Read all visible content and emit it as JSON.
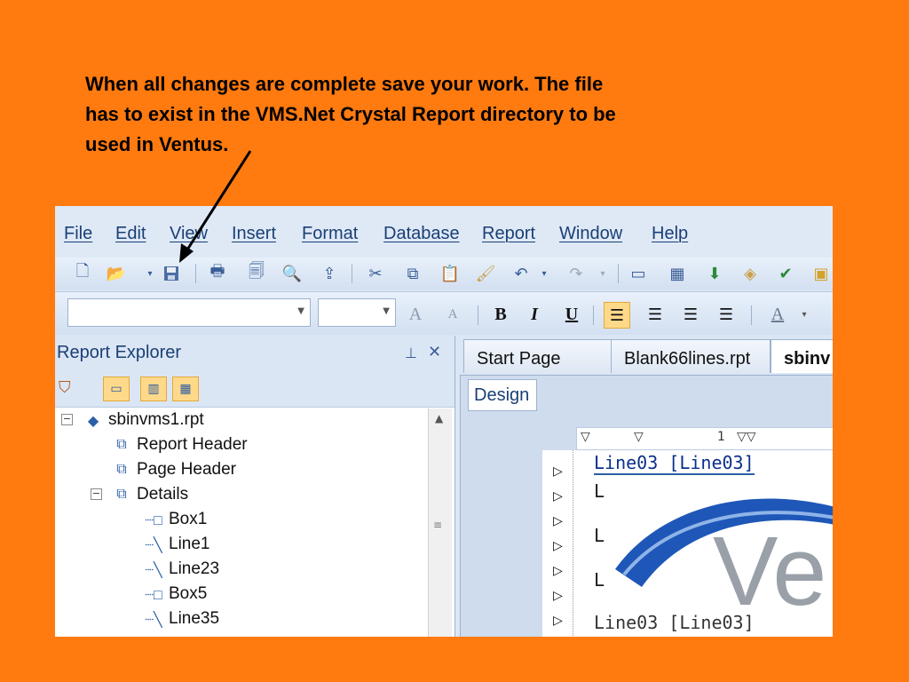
{
  "caption": {
    "line1": "When all changes are complete save your work.  The file",
    "line2": "has to exist in the VMS.Net Crystal Report directory to be",
    "line3": "used in Ventus."
  },
  "menu": [
    "File",
    "Edit",
    "View",
    "Insert",
    "Format",
    "Database",
    "Report",
    "Window",
    "Help"
  ],
  "toolbar_icons": [
    "new-icon",
    "open-icon",
    "save-icon",
    "print-icon",
    "print-preview-icon",
    "preview-icon",
    "export-icon",
    "cut-icon",
    "copy-icon",
    "paste-icon",
    "format-painter-icon",
    "undo-icon",
    "redo-icon",
    "field-explorer-icon",
    "toolbox-icon",
    "insert-icon",
    "expert-icon",
    "check-icon"
  ],
  "format": {
    "bold": "B",
    "italic": "I",
    "underline": "U",
    "font_grow": "A",
    "font_shrink": "A",
    "font_color": "A"
  },
  "explorer": {
    "title": "Report Explorer",
    "pin": "ф",
    "close": "✕",
    "items": [
      {
        "label": "sbinvms1.rpt",
        "type": "report"
      },
      {
        "label": "Report Header",
        "type": "section"
      },
      {
        "label": "Page Header",
        "type": "section"
      },
      {
        "label": "Details",
        "type": "section"
      },
      {
        "label": "Box1",
        "type": "box"
      },
      {
        "label": "Line1",
        "type": "line"
      },
      {
        "label": "Line23",
        "type": "line"
      },
      {
        "label": "Box5",
        "type": "box"
      },
      {
        "label": "Line35",
        "type": "line"
      }
    ]
  },
  "tabs": [
    "Start Page",
    "Blank66lines.rpt",
    "sbinv"
  ],
  "design_tab": "Design",
  "ruler_text": "1",
  "canvas": {
    "line_a": "Line03  [Line03]",
    "line_b": "Line03  [Line03]",
    "logo_text": "Ve",
    "short_label": "L"
  }
}
